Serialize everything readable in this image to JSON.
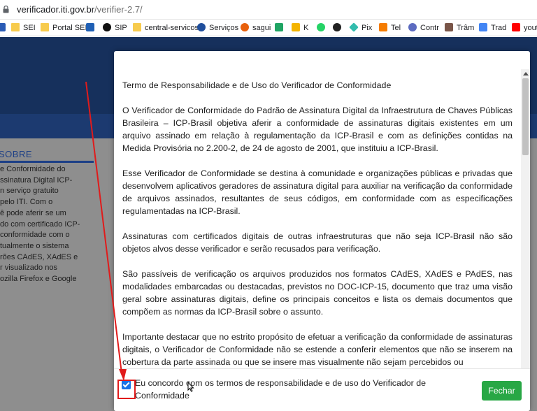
{
  "browser": {
    "url_host": "verificador.iti.gov.br",
    "url_path": "/verifier-2.7/"
  },
  "bookmarks": [
    {
      "label": "SEI",
      "icon": "folder-icon",
      "color": "#f7cb4d"
    },
    {
      "label": "Portal SEI",
      "icon": "folder-icon",
      "color": "#f7cb4d"
    },
    {
      "label": "SIP",
      "icon": "sip-icon",
      "color": "#000000"
    },
    {
      "label": "central-servicos",
      "icon": "folder-icon",
      "color": "#f7cb4d"
    },
    {
      "label": "Serviços",
      "icon": "gov-star-icon",
      "color": "#1f4e9c"
    },
    {
      "label": "sagui",
      "icon": "sagui-icon",
      "color": "#e8600c"
    },
    {
      "label": "",
      "icon": "drive-icon",
      "color": "#1fa463"
    },
    {
      "label": "K",
      "icon": "keep-icon",
      "color": "#f4b400"
    },
    {
      "label": "",
      "icon": "whatsapp-icon",
      "color": "#25d366"
    },
    {
      "label": "Pix",
      "icon": "pix-icon",
      "color": "#32bcad"
    },
    {
      "label": "Tel",
      "icon": "tel-icon",
      "color": "#f57c00"
    },
    {
      "label": "Contr",
      "icon": "contr-icon",
      "color": "#5c6bc0"
    },
    {
      "label": "Trâm",
      "icon": "tram-icon",
      "color": "#795548"
    },
    {
      "label": "Trad",
      "icon": "translate-icon",
      "color": "#4285f4"
    },
    {
      "label": "youtu",
      "icon": "youtube-icon",
      "color": "#ff0000"
    }
  ],
  "background_page": {
    "sobre_title": "SOBRE",
    "sobre_lines": [
      "e Conformidade do",
      "ssinatura Digital ICP-",
      "n serviço gratuito",
      "pelo ITI. Com o",
      "ê pode aferir se um",
      "do com certificado ICP-",
      "conformidade com o",
      "tualmente o sistema",
      "rões CAdES, XAdES e",
      "r visualizado nos",
      "ozilla Firefox e Google"
    ]
  },
  "modal": {
    "title": "Termo de Responsabilidade e de Uso do Verificador de Conformidade",
    "paragraphs": [
      "O Verificador de Conformidade do Padrão de Assinatura Digital da Infraestrutura de Chaves Públicas Brasileira – ICP-Brasil objetiva aferir a conformidade de assinaturas digitais existentes em um arquivo assinado em relação à regulamentação da ICP-Brasil e com as definições contidas na Medida Provisória no 2.200-2, de 24 de agosto de 2001, que instituiu a ICP-Brasil.",
      "Esse Verificador de Conformidade se destina à comunidade e organizações públicas e privadas que desenvolvem aplicativos geradores de assinatura digital para auxiliar na verificação da conformidade de arquivos assinados, resultantes de seus códigos, em conformidade com as especificações regulamentadas na ICP-Brasil.",
      "Assinaturas com certificados digitais de outras infraestruturas que não seja ICP-Brasil não são objetos alvos desse verificador e serão recusados para verificação.",
      "São passíveis de verificação os arquivos produzidos nos formatos CAdES, XAdES e PAdES, nas modalidades embarcadas ou destacadas, previstos no DOC-ICP-15, documento que traz uma visão geral sobre assinaturas digitais, define os principais conceitos e lista os demais documentos que compõem as normas da ICP-Brasil sobre o assunto.",
      "Importante destacar que no estrito propósito de efetuar a verificação da conformidade de assinaturas digitais, o Verificador de Conformidade não se estende a conferir elementos que não se inserem na cobertura da parte assinada ou que se insere mas visualmente não sejam percebidos ou"
    ],
    "agree_label": "Eu concordo com os termos de responsabilidade e de uso do Verificador de Conformidade",
    "agree_checked": true,
    "close_label": "Fechar"
  },
  "colors": {
    "accent_green": "#28a745",
    "annotation_red": "#e11b1b",
    "checkbox_blue": "#1a73e8"
  }
}
